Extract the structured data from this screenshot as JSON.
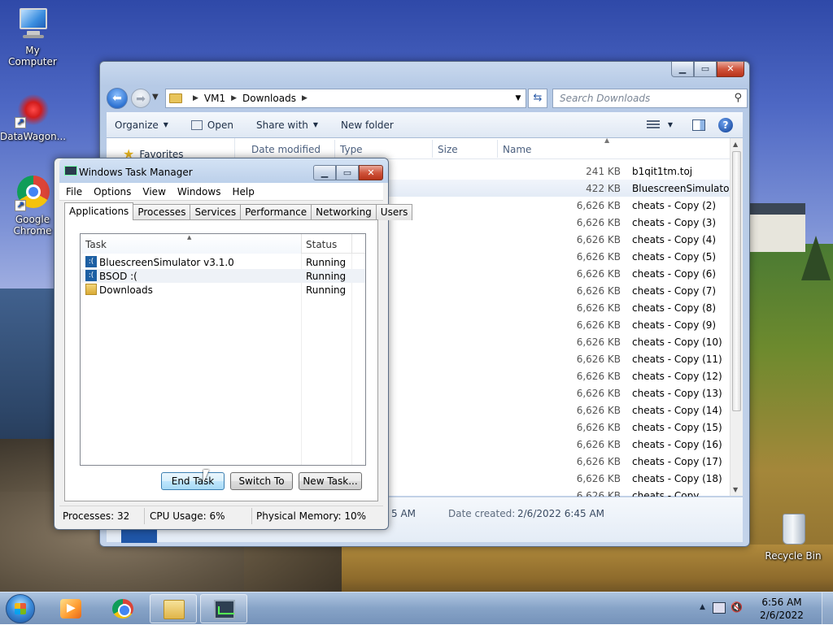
{
  "desktop": {
    "icons": [
      {
        "label": "My Computer",
        "icon": "my-computer-icon"
      },
      {
        "label": "DataWagon...",
        "icon": "datawagon-icon"
      },
      {
        "label": "Google Chrome",
        "icon": "chrome-icon"
      },
      {
        "label": "Recycle Bin",
        "icon": "recycle-bin-icon"
      }
    ]
  },
  "explorer": {
    "breadcrumb": [
      "VM1",
      "Downloads"
    ],
    "search_placeholder": "Search Downloads",
    "toolbar": {
      "organize": "Organize",
      "open": "Open",
      "share_with": "Share with",
      "new_folder": "New folder"
    },
    "nav_favorites": "Favorites",
    "columns": {
      "date_modified": "Date modified",
      "type": "Type",
      "size": "Size",
      "name": "Name"
    },
    "files": [
      {
        "size": "241 KB",
        "name": "b1qit1tm.toj"
      },
      {
        "size": "422 KB",
        "name": "BluescreenSimulator"
      },
      {
        "size": "6,626 KB",
        "name": "cheats - Copy (2)"
      },
      {
        "size": "6,626 KB",
        "name": "cheats - Copy (3)"
      },
      {
        "size": "6,626 KB",
        "name": "cheats - Copy (4)"
      },
      {
        "size": "6,626 KB",
        "name": "cheats - Copy (5)"
      },
      {
        "size": "6,626 KB",
        "name": "cheats - Copy (6)"
      },
      {
        "size": "6,626 KB",
        "name": "cheats - Copy (7)"
      },
      {
        "size": "6,626 KB",
        "name": "cheats - Copy (8)"
      },
      {
        "size": "6,626 KB",
        "name": "cheats - Copy (9)"
      },
      {
        "size": "6,626 KB",
        "name": "cheats - Copy (10)"
      },
      {
        "size": "6,626 KB",
        "name": "cheats - Copy (11)"
      },
      {
        "size": "6,626 KB",
        "name": "cheats - Copy (12)"
      },
      {
        "size": "6,626 KB",
        "name": "cheats - Copy (13)"
      },
      {
        "size": "6,626 KB",
        "name": "cheats - Copy (14)"
      },
      {
        "size": "6,626 KB",
        "name": "cheats - Copy (15)"
      },
      {
        "size": "6,626 KB",
        "name": "cheats - Copy (16)"
      },
      {
        "size": "6,626 KB",
        "name": "cheats - Copy (17)"
      },
      {
        "size": "6,626 KB",
        "name": "cheats - Copy (18)"
      },
      {
        "size": "6,626 KB",
        "name": "cheats - Copy"
      }
    ],
    "details": {
      "modified_partial": "5 AM",
      "created_label": "Date created:",
      "created_value": "2/6/2022 6:45 AM"
    }
  },
  "taskmgr": {
    "title": "Windows Task Manager",
    "menu": [
      "File",
      "Options",
      "View",
      "Windows",
      "Help"
    ],
    "tabs": [
      "Applications",
      "Processes",
      "Services",
      "Performance",
      "Networking",
      "Users"
    ],
    "columns": {
      "task": "Task",
      "status": "Status"
    },
    "tasks": [
      {
        "name": "BluescreenSimulator v3.1.0",
        "status": "Running",
        "icon": "bsod-icon"
      },
      {
        "name": "BSOD :(",
        "status": "Running",
        "icon": "bsod-icon"
      },
      {
        "name": "Downloads",
        "status": "Running",
        "icon": "folder-icon"
      }
    ],
    "buttons": {
      "end_task": "End Task",
      "switch_to": "Switch To",
      "new_task": "New Task..."
    },
    "status": {
      "processes": "Processes: 32",
      "cpu": "CPU Usage: 6%",
      "memory": "Physical Memory: 10%"
    }
  },
  "taskbar": {
    "clock_time": "6:56 AM",
    "clock_date": "2/6/2022"
  }
}
